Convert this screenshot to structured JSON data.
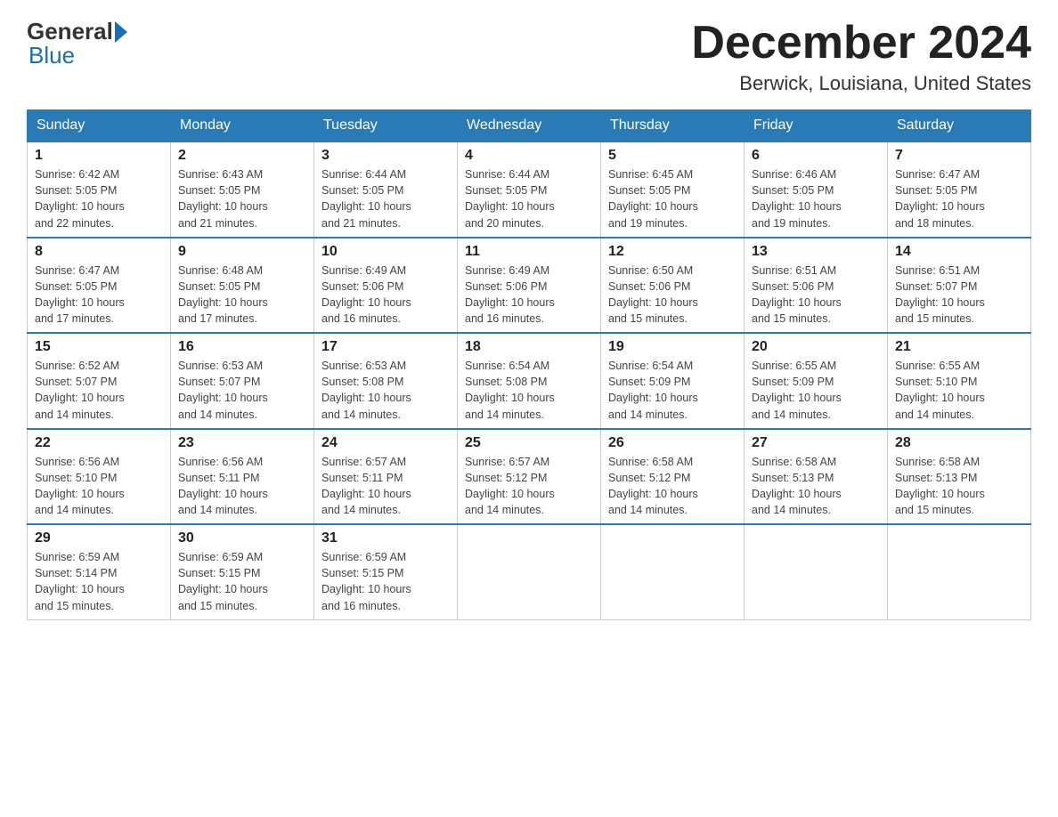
{
  "header": {
    "logo_general": "General",
    "logo_blue": "Blue",
    "title": "December 2024",
    "subtitle": "Berwick, Louisiana, United States"
  },
  "days_of_week": [
    "Sunday",
    "Monday",
    "Tuesday",
    "Wednesday",
    "Thursday",
    "Friday",
    "Saturday"
  ],
  "weeks": [
    [
      {
        "day": "1",
        "sunrise": "6:42 AM",
        "sunset": "5:05 PM",
        "daylight": "10 hours and 22 minutes."
      },
      {
        "day": "2",
        "sunrise": "6:43 AM",
        "sunset": "5:05 PM",
        "daylight": "10 hours and 21 minutes."
      },
      {
        "day": "3",
        "sunrise": "6:44 AM",
        "sunset": "5:05 PM",
        "daylight": "10 hours and 21 minutes."
      },
      {
        "day": "4",
        "sunrise": "6:44 AM",
        "sunset": "5:05 PM",
        "daylight": "10 hours and 20 minutes."
      },
      {
        "day": "5",
        "sunrise": "6:45 AM",
        "sunset": "5:05 PM",
        "daylight": "10 hours and 19 minutes."
      },
      {
        "day": "6",
        "sunrise": "6:46 AM",
        "sunset": "5:05 PM",
        "daylight": "10 hours and 19 minutes."
      },
      {
        "day": "7",
        "sunrise": "6:47 AM",
        "sunset": "5:05 PM",
        "daylight": "10 hours and 18 minutes."
      }
    ],
    [
      {
        "day": "8",
        "sunrise": "6:47 AM",
        "sunset": "5:05 PM",
        "daylight": "10 hours and 17 minutes."
      },
      {
        "day": "9",
        "sunrise": "6:48 AM",
        "sunset": "5:05 PM",
        "daylight": "10 hours and 17 minutes."
      },
      {
        "day": "10",
        "sunrise": "6:49 AM",
        "sunset": "5:06 PM",
        "daylight": "10 hours and 16 minutes."
      },
      {
        "day": "11",
        "sunrise": "6:49 AM",
        "sunset": "5:06 PM",
        "daylight": "10 hours and 16 minutes."
      },
      {
        "day": "12",
        "sunrise": "6:50 AM",
        "sunset": "5:06 PM",
        "daylight": "10 hours and 15 minutes."
      },
      {
        "day": "13",
        "sunrise": "6:51 AM",
        "sunset": "5:06 PM",
        "daylight": "10 hours and 15 minutes."
      },
      {
        "day": "14",
        "sunrise": "6:51 AM",
        "sunset": "5:07 PM",
        "daylight": "10 hours and 15 minutes."
      }
    ],
    [
      {
        "day": "15",
        "sunrise": "6:52 AM",
        "sunset": "5:07 PM",
        "daylight": "10 hours and 14 minutes."
      },
      {
        "day": "16",
        "sunrise": "6:53 AM",
        "sunset": "5:07 PM",
        "daylight": "10 hours and 14 minutes."
      },
      {
        "day": "17",
        "sunrise": "6:53 AM",
        "sunset": "5:08 PM",
        "daylight": "10 hours and 14 minutes."
      },
      {
        "day": "18",
        "sunrise": "6:54 AM",
        "sunset": "5:08 PM",
        "daylight": "10 hours and 14 minutes."
      },
      {
        "day": "19",
        "sunrise": "6:54 AM",
        "sunset": "5:09 PM",
        "daylight": "10 hours and 14 minutes."
      },
      {
        "day": "20",
        "sunrise": "6:55 AM",
        "sunset": "5:09 PM",
        "daylight": "10 hours and 14 minutes."
      },
      {
        "day": "21",
        "sunrise": "6:55 AM",
        "sunset": "5:10 PM",
        "daylight": "10 hours and 14 minutes."
      }
    ],
    [
      {
        "day": "22",
        "sunrise": "6:56 AM",
        "sunset": "5:10 PM",
        "daylight": "10 hours and 14 minutes."
      },
      {
        "day": "23",
        "sunrise": "6:56 AM",
        "sunset": "5:11 PM",
        "daylight": "10 hours and 14 minutes."
      },
      {
        "day": "24",
        "sunrise": "6:57 AM",
        "sunset": "5:11 PM",
        "daylight": "10 hours and 14 minutes."
      },
      {
        "day": "25",
        "sunrise": "6:57 AM",
        "sunset": "5:12 PM",
        "daylight": "10 hours and 14 minutes."
      },
      {
        "day": "26",
        "sunrise": "6:58 AM",
        "sunset": "5:12 PM",
        "daylight": "10 hours and 14 minutes."
      },
      {
        "day": "27",
        "sunrise": "6:58 AM",
        "sunset": "5:13 PM",
        "daylight": "10 hours and 14 minutes."
      },
      {
        "day": "28",
        "sunrise": "6:58 AM",
        "sunset": "5:13 PM",
        "daylight": "10 hours and 15 minutes."
      }
    ],
    [
      {
        "day": "29",
        "sunrise": "6:59 AM",
        "sunset": "5:14 PM",
        "daylight": "10 hours and 15 minutes."
      },
      {
        "day": "30",
        "sunrise": "6:59 AM",
        "sunset": "5:15 PM",
        "daylight": "10 hours and 15 minutes."
      },
      {
        "day": "31",
        "sunrise": "6:59 AM",
        "sunset": "5:15 PM",
        "daylight": "10 hours and 16 minutes."
      },
      null,
      null,
      null,
      null
    ]
  ],
  "labels": {
    "sunrise": "Sunrise:",
    "sunset": "Sunset:",
    "daylight": "Daylight:"
  }
}
